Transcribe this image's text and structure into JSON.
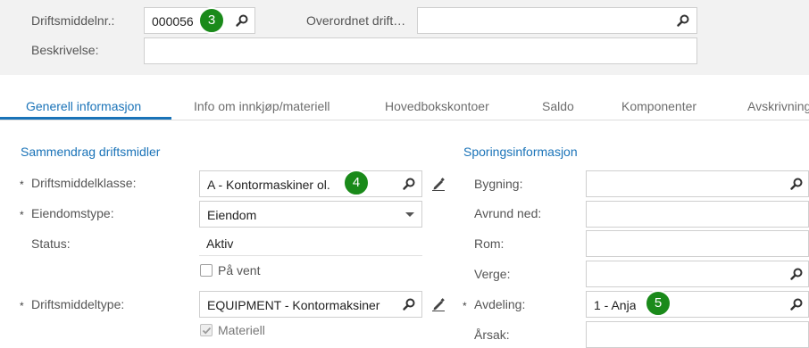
{
  "header": {
    "asset_no_label": "Driftsmiddelnr.:",
    "asset_no_value": "000056",
    "parent_label": "Overordnet drift…",
    "parent_value": "",
    "description_label": "Beskrivelse:",
    "description_value": ""
  },
  "badges": {
    "b3": "3",
    "b4": "4",
    "b5": "5"
  },
  "tabs": [
    {
      "label": "Generell informasjon",
      "active": true
    },
    {
      "label": "Info om innkjøp/materiell"
    },
    {
      "label": "Hovedbokskontoer"
    },
    {
      "label": "Saldo"
    },
    {
      "label": "Komponenter"
    },
    {
      "label": "Avskrivning"
    }
  ],
  "left": {
    "section_title": "Sammendrag driftsmidler",
    "class_label": "Driftsmiddelklasse:",
    "class_value": "A - Kontormaskiner ol.",
    "property_type_label": "Eiendomstype:",
    "property_type_value": "Eiendom",
    "status_label": "Status:",
    "status_value": "Aktiv",
    "on_hold_label": "På vent",
    "asset_type_label": "Driftsmiddeltype:",
    "asset_type_value": "EQUIPMENT - Kontormaksiner",
    "material_label": "Materiell"
  },
  "right": {
    "section_title": "Sporingsinformasjon",
    "building_label": "Bygning:",
    "building_value": "",
    "round_down_label": "Avrund ned:",
    "round_down_value": "",
    "room_label": "Rom:",
    "room_value": "",
    "guardian_label": "Verge:",
    "guardian_value": "",
    "department_label": "Avdeling:",
    "department_value": "1 - Anja",
    "reason_label": "Årsak:",
    "reason_value": ""
  },
  "required_mark": "*",
  "colors": {
    "accent": "#1a73b8",
    "badge": "#1a8a1a",
    "header_bg": "#f2f2f2"
  }
}
